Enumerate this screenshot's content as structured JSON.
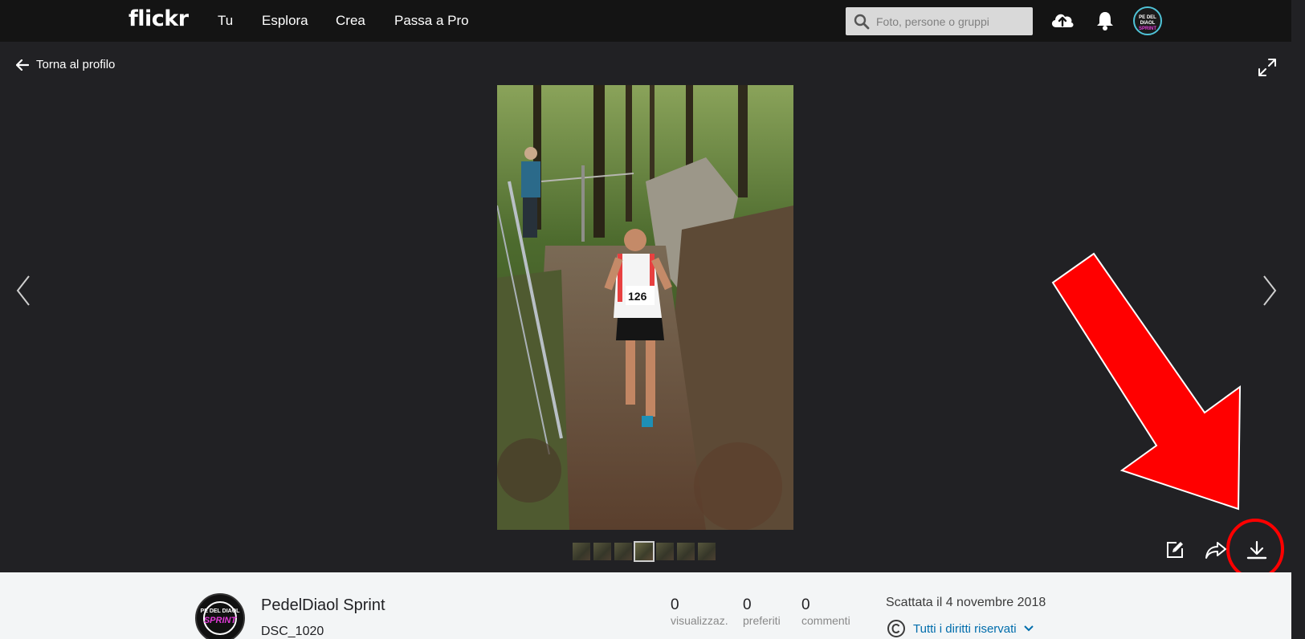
{
  "nav": {
    "logo": "flickr",
    "links": [
      "Tu",
      "Esplora",
      "Crea",
      "Passa a Pro"
    ],
    "search_placeholder": "Foto, persone o gruppi"
  },
  "viewer": {
    "back_label": "Torna al profilo",
    "thumbnail_count": 7,
    "active_thumbnail": 4
  },
  "info": {
    "owner": "PedelDiaol Sprint",
    "title": "DSC_1020",
    "stats": [
      {
        "value": "0",
        "label": "visualizzaz."
      },
      {
        "value": "0",
        "label": "preferiti"
      },
      {
        "value": "0",
        "label": "commenti"
      }
    ],
    "taken": "Scattata il 4 novembre 2018",
    "license": "Tutti i diritti riservati"
  },
  "photo_bib_number": "126",
  "colors": {
    "topbar": "#141414",
    "viewer_bg": "#212124",
    "infobar_bg": "#f3f5f6",
    "link_blue": "#006dac",
    "annotation_red": "#ff0000"
  }
}
